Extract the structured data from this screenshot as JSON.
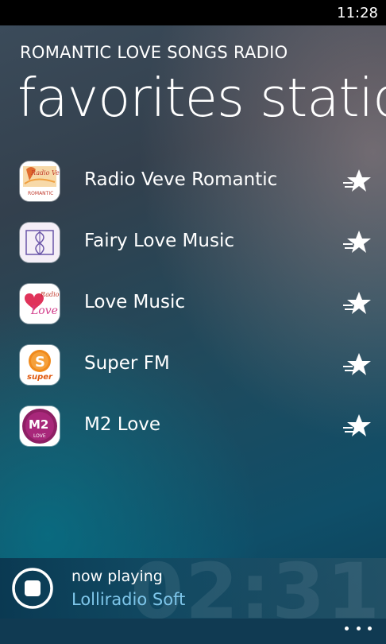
{
  "status_bar": {
    "time": "11:28"
  },
  "header": {
    "app_title": "ROMANTIC LOVE SONGS RADIO",
    "page_title": "favorites stations"
  },
  "stations": [
    {
      "name": "Radio Veve Romantic",
      "logo_icon": "radio-veve-logo-icon",
      "favorite": true
    },
    {
      "name": "Fairy Love Music",
      "logo_icon": "fairy-love-logo-icon",
      "favorite": true
    },
    {
      "name": "Love Music",
      "logo_icon": "love-music-logo-icon",
      "favorite": true
    },
    {
      "name": "Super FM",
      "logo_icon": "super-fm-logo-icon",
      "favorite": true
    },
    {
      "name": "M2 Love",
      "logo_icon": "m2-love-logo-icon",
      "favorite": true
    }
  ],
  "now_playing": {
    "label": "now playing",
    "station": "Lolliradio Soft",
    "elapsed": "02:31"
  },
  "colors": {
    "accent": "#7ec6ea",
    "now_playing_bg": "#0e3a55",
    "text": "#ffffff"
  }
}
